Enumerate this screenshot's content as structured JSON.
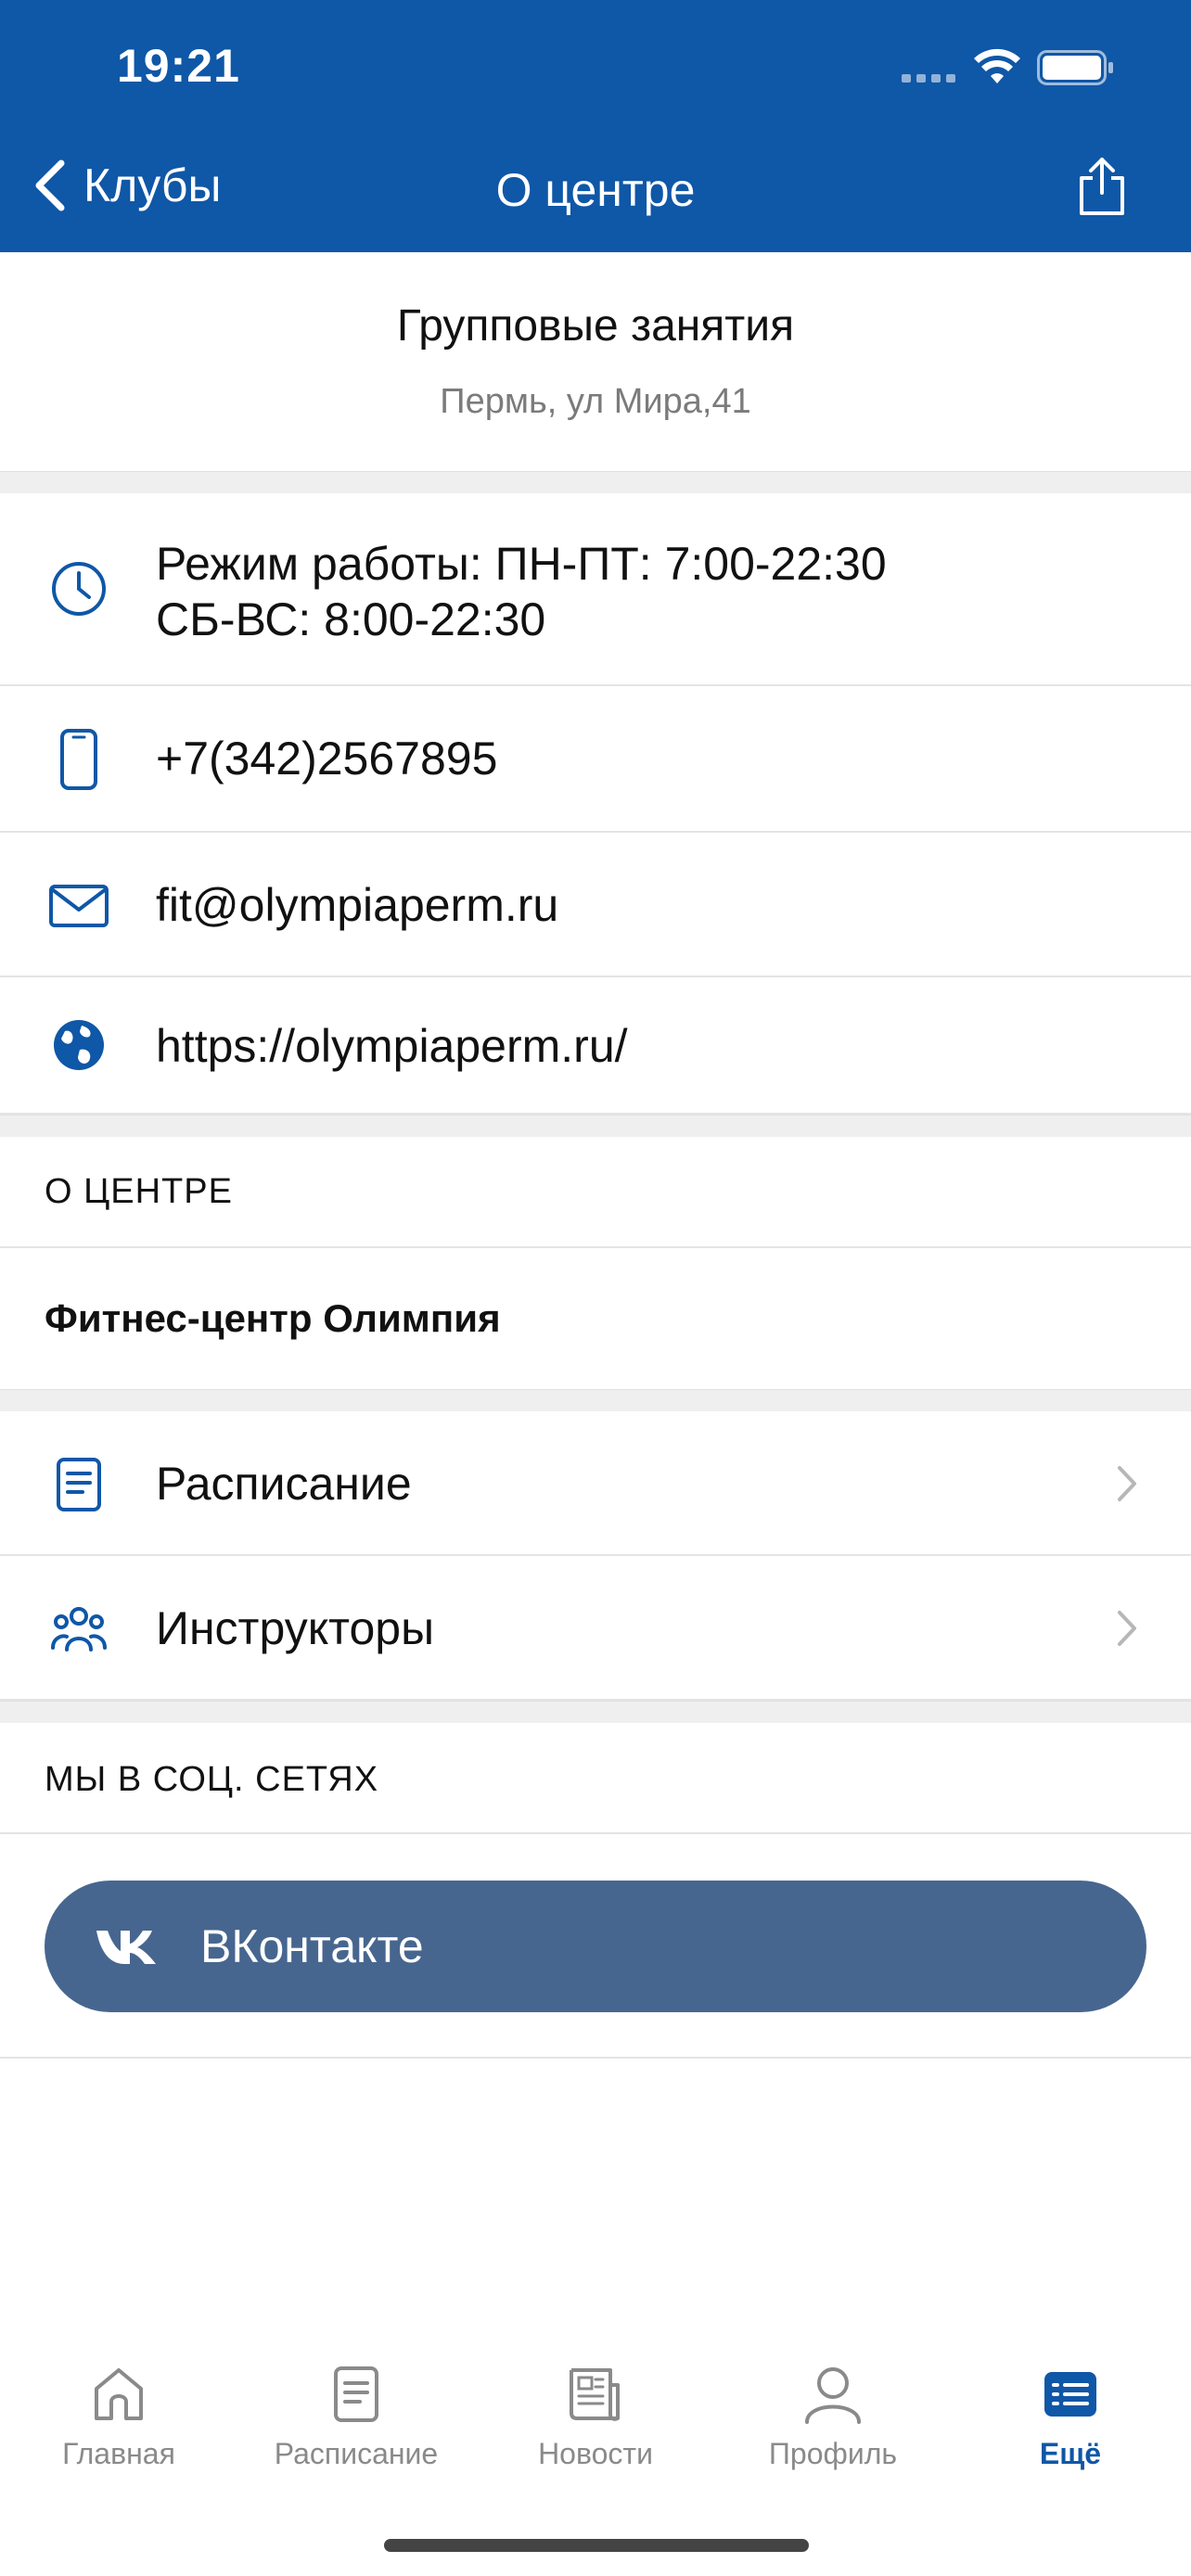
{
  "status_bar": {
    "time": "19:21"
  },
  "nav": {
    "back_label": "Клубы",
    "title": "О центре"
  },
  "club": {
    "name": "Групповые занятия",
    "address": "Пермь, ул Мира,41"
  },
  "contacts": {
    "hours_line1": "Режим работы: ПН-ПТ: 7:00-22:30",
    "hours_line2": "СБ-ВС: 8:00-22:30",
    "phone": "+7(342)2567895",
    "email": "fit@olympiaperm.ru",
    "website": "https://olympiaperm.ru/"
  },
  "about": {
    "section_title": "О ЦЕНТРЕ",
    "description": "Фитнес-центр Олимпия"
  },
  "links": [
    {
      "label": "Расписание"
    },
    {
      "label": "Инструкторы"
    }
  ],
  "social": {
    "section_title": "МЫ В СОЦ. СЕТЯХ",
    "vk_label": "ВКонтакте"
  },
  "tabbar": {
    "tabs": [
      {
        "label": "Главная",
        "icon": "home-icon"
      },
      {
        "label": "Расписание",
        "icon": "document-icon"
      },
      {
        "label": "Новости",
        "icon": "newspaper-icon"
      },
      {
        "label": "Профиль",
        "icon": "person-icon"
      },
      {
        "label": "Ещё",
        "icon": "list-icon"
      }
    ],
    "active_index": 4
  },
  "colors": {
    "brand": "#0f57a7",
    "vk": "#47668f",
    "separator": "#efefef"
  }
}
